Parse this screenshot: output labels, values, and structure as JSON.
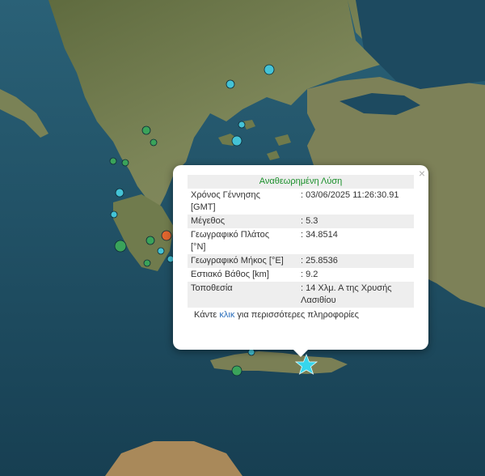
{
  "popup": {
    "title": "Αναθεωρημένη Λύση",
    "close_label": "×",
    "fields": [
      {
        "label": "Χρόνος Γέννησης [GMT]",
        "value": ": 03/06/2025 11:26:30.91"
      },
      {
        "label": "Μέγεθος",
        "value": ": 5.3"
      },
      {
        "label": "Γεωγραφικό Πλάτος [°N]",
        "value": ": 34.8514"
      },
      {
        "label": "Γεωγραφικό Μήκος [°E]",
        "value": ": 25.8536"
      },
      {
        "label": "Εστιακό Βάθος [km]",
        "value": ": 9.2"
      },
      {
        "label": "Τοποθεσία",
        "value": ": 14 Χλμ. Α της Χρυσής Λασιθίου"
      }
    ],
    "more_prefix": "Κάντε ",
    "more_link": "κλικ",
    "more_suffix": " για περισσότερες πληροφορίες"
  },
  "colors": {
    "sea": "#1f4d62",
    "land": "#6f7a4c",
    "marker_green": "#3aa35a",
    "marker_cyan": "#44c3d6",
    "marker_orange": "#e0662e",
    "epicenter_star": "#36d6ec"
  },
  "markers": [
    {
      "type": "cyan"
    },
    {
      "type": "cyan"
    },
    {
      "type": "cyan"
    },
    {
      "type": "cyan"
    },
    {
      "type": "green"
    },
    {
      "type": "green"
    },
    {
      "type": "green"
    },
    {
      "type": "green"
    },
    {
      "type": "orange"
    },
    {
      "type": "green"
    },
    {
      "type": "cyan"
    },
    {
      "type": "cyan"
    },
    {
      "type": "green"
    },
    {
      "type": "cyan"
    },
    {
      "type": "green"
    },
    {
      "type": "cyan"
    },
    {
      "type": "green"
    },
    {
      "type": "cyan"
    }
  ],
  "epicenter": {
    "icon": "star-icon"
  }
}
